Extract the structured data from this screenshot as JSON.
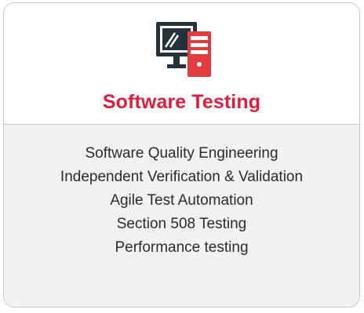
{
  "card": {
    "icon": "computer-server-icon",
    "title": "Software Testing",
    "services": [
      "Software Quality Engineering",
      "Independent Verification & Validation",
      "Agile Test Automation",
      "Section 508 Testing",
      "Performance testing"
    ]
  },
  "colors": {
    "accent": "#e21d3b",
    "icon_dark": "#24323c",
    "icon_red": "#e23c3c",
    "body_bg": "#f1f1f1",
    "border": "#c9c9c9"
  }
}
